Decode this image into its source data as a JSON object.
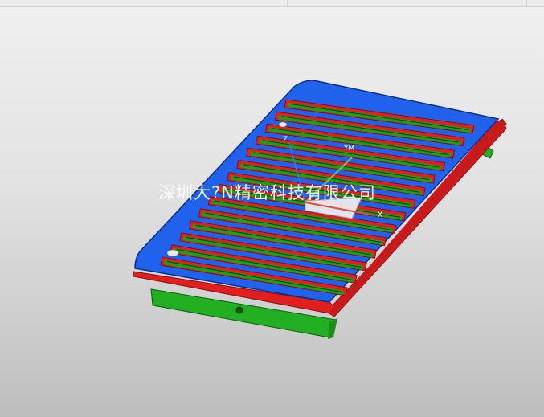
{
  "watermark": {
    "text": "深圳大?N精密科技有限公司"
  },
  "faint_watermark": {
    "text": ""
  },
  "axis_labels": {
    "x": "X",
    "y": "YM",
    "z": "Z"
  },
  "colors": {
    "top_face": "#1f5ee8",
    "side_face": "#e21e1e",
    "slot_floor": "#16a316",
    "base_block": "#22b022",
    "background": "#dcdcdc"
  },
  "model": {
    "slot_count": 14
  }
}
